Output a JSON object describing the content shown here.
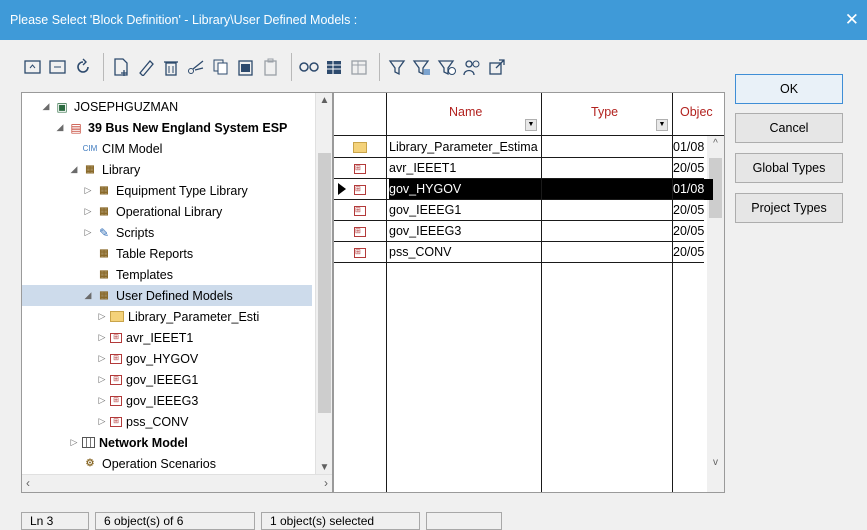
{
  "window": {
    "title": "Please Select 'Block Definition' - Library\\User Defined Models :",
    "close_icon": "close-icon"
  },
  "toolbar": [
    {
      "name": "up-level-icon",
      "enabled": true
    },
    {
      "name": "expand-icon",
      "enabled": true
    },
    {
      "name": "refresh-icon",
      "enabled": true
    },
    {
      "sep": true
    },
    {
      "name": "new-object-icon",
      "enabled": true
    },
    {
      "name": "edit-icon",
      "enabled": true
    },
    {
      "name": "delete-icon",
      "enabled": true
    },
    {
      "name": "cut-icon",
      "enabled": true
    },
    {
      "name": "copy-icon",
      "enabled": true
    },
    {
      "name": "paste-icon",
      "enabled": true
    },
    {
      "name": "paste-special-icon",
      "enabled": false
    },
    {
      "sep": true
    },
    {
      "name": "detail-mode-icon",
      "enabled": true
    },
    {
      "name": "edit-relevant-objects-icon",
      "enabled": true
    },
    {
      "name": "table-icon",
      "enabled": false
    },
    {
      "sep": true
    },
    {
      "name": "filter-icon",
      "enabled": true
    },
    {
      "name": "filter-advanced-icon",
      "enabled": true
    },
    {
      "name": "filter-time-icon",
      "enabled": true
    },
    {
      "name": "find-users-icon",
      "enabled": true
    },
    {
      "name": "open-external-icon",
      "enabled": true
    }
  ],
  "tree": [
    {
      "label": "JOSEPHGUZMAN",
      "bold": false,
      "arrow": "expanded",
      "icon": "user-icon",
      "indent": 0
    },
    {
      "label": "39 Bus New England System ESP",
      "bold": true,
      "arrow": "expanded",
      "icon": "project-icon",
      "indent": 1
    },
    {
      "label": "CIM Model",
      "bold": false,
      "arrow": "",
      "icon": "cim-icon",
      "indent": 2
    },
    {
      "label": "Library",
      "bold": false,
      "arrow": "expanded",
      "icon": "library-icon",
      "indent": 2
    },
    {
      "label": "Equipment Type Library",
      "bold": false,
      "arrow": "collapsed",
      "icon": "library-icon",
      "indent": 3
    },
    {
      "label": "Operational Library",
      "bold": false,
      "arrow": "collapsed",
      "icon": "library-icon",
      "indent": 3
    },
    {
      "label": "Scripts",
      "bold": false,
      "arrow": "collapsed",
      "icon": "script-icon",
      "indent": 3
    },
    {
      "label": "Table Reports",
      "bold": false,
      "arrow": "",
      "icon": "library-icon",
      "indent": 3
    },
    {
      "label": "Templates",
      "bold": false,
      "arrow": "",
      "icon": "library-icon",
      "indent": 3
    },
    {
      "label": "User Defined Models",
      "bold": false,
      "arrow": "expanded",
      "icon": "library-icon",
      "indent": 3,
      "selected": true
    },
    {
      "label": "Library_Parameter_Esti",
      "bold": false,
      "arrow": "collapsed",
      "icon": "folder-icon",
      "indent": 4
    },
    {
      "label": "avr_IEEET1",
      "bold": false,
      "arrow": "collapsed",
      "icon": "model-block-icon",
      "indent": 4
    },
    {
      "label": "gov_HYGOV",
      "bold": false,
      "arrow": "collapsed",
      "icon": "model-block-icon",
      "indent": 4
    },
    {
      "label": "gov_IEEEG1",
      "bold": false,
      "arrow": "collapsed",
      "icon": "model-block-icon",
      "indent": 4
    },
    {
      "label": "gov_IEEEG3",
      "bold": false,
      "arrow": "collapsed",
      "icon": "model-block-icon",
      "indent": 4
    },
    {
      "label": "pss_CONV",
      "bold": false,
      "arrow": "collapsed",
      "icon": "model-block-icon",
      "indent": 4
    },
    {
      "label": "Network Model",
      "bold": true,
      "arrow": "collapsed",
      "icon": "network-icon",
      "indent": 2
    },
    {
      "label": "Operation Scenarios",
      "bold": false,
      "arrow": "",
      "icon": "scenario-icon",
      "indent": 2
    }
  ],
  "grid": {
    "columns": [
      "Name",
      "Type",
      "Objec"
    ],
    "rows": [
      {
        "name": "Library_Parameter_Estima",
        "type": "",
        "date": "01/08",
        "icon": "folder-icon",
        "selected": false
      },
      {
        "name": "avr_IEEET1",
        "type": "",
        "date": "20/05",
        "icon": "model-block-icon",
        "selected": false
      },
      {
        "name": "gov_HYGOV",
        "type": "",
        "date": "01/08",
        "icon": "model-block-icon",
        "selected": true
      },
      {
        "name": "gov_IEEEG1",
        "type": "",
        "date": "20/05",
        "icon": "model-block-icon",
        "selected": false
      },
      {
        "name": "gov_IEEEG3",
        "type": "",
        "date": "20/05",
        "icon": "model-block-icon",
        "selected": false
      },
      {
        "name": "pss_CONV",
        "type": "",
        "date": "20/05",
        "icon": "model-block-icon",
        "selected": false
      }
    ]
  },
  "buttons": {
    "ok": "OK",
    "cancel": "Cancel",
    "global_types": "Global Types",
    "project_types": "Project Types"
  },
  "status": {
    "line": "Ln 3",
    "count": "6 object(s) of 6",
    "selected": "1 object(s) selected",
    "extra": ""
  }
}
